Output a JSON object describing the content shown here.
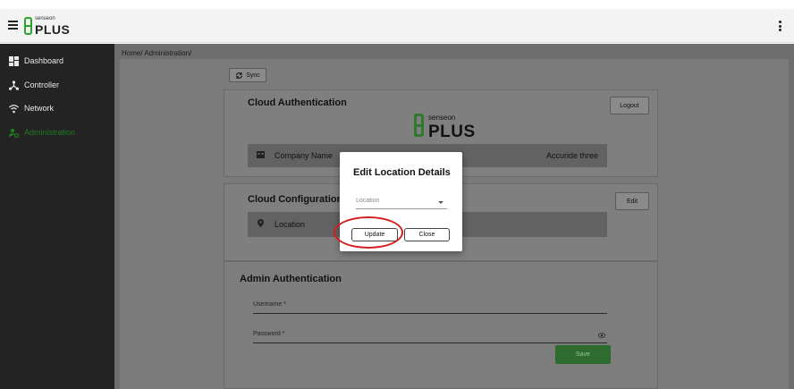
{
  "app": {
    "brand_top": "senseon",
    "brand_main": "PLUS"
  },
  "icons": {
    "menu": "hamburger-menu-icon",
    "more": "vertical-dots-icon",
    "dashboard": "dashboard-grid-icon",
    "controller": "controller-hub-icon",
    "network": "wifi-icon",
    "administration": "admin-gear-icon",
    "sync": "sync-icon",
    "company": "building-icon",
    "location": "location-pin-icon",
    "eye": "eye-icon",
    "caret": "chevron-down-icon"
  },
  "colors": {
    "brand_green": "#2aa52a",
    "active_nav": "#1f7a1f",
    "save_button": "#2e6b2e",
    "highlight": "#d21f1f"
  },
  "sidebar": {
    "items": [
      {
        "label": "Dashboard"
      },
      {
        "label": "Controller"
      },
      {
        "label": "Network"
      },
      {
        "label": "Administration"
      }
    ]
  },
  "breadcrumb": "Home/ Administration/",
  "toolbar": {
    "sync_label": "Sync"
  },
  "cloud_auth": {
    "title": "Cloud Authentication",
    "logout_label": "Logout",
    "logo_top": "senseon",
    "logo_main": "PLUS",
    "company_label": "Company Name",
    "company_value": "Accuride three"
  },
  "cloud_config": {
    "title": "Cloud Configuration",
    "edit_label": "Edit",
    "location_label": "Location"
  },
  "admin_auth": {
    "title": "Admin Authentication",
    "username_label": "Username *",
    "password_label": "Password *",
    "save_label": "Save"
  },
  "modal": {
    "title": "Edit Location Details",
    "location_placeholder": "Location",
    "update_label": "Update",
    "close_label": "Close"
  }
}
